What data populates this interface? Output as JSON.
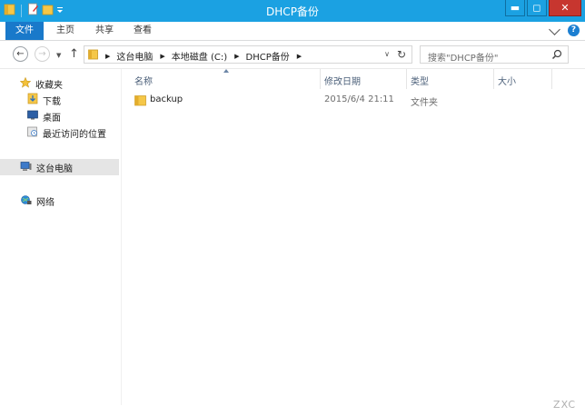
{
  "window": {
    "title": "DHCP备份",
    "minimize_glyph": "▬",
    "maximize_glyph": "◻",
    "close_glyph": "✕"
  },
  "ribbon": {
    "tabs": [
      {
        "label": "文件",
        "active": true
      },
      {
        "label": "主页"
      },
      {
        "label": "共享"
      },
      {
        "label": "查看"
      }
    ],
    "help_glyph": "?"
  },
  "nav": {
    "back_glyph": "←",
    "forward_glyph": "→",
    "recent_glyph": "▼",
    "up_glyph": "↑"
  },
  "address": {
    "breadcrumbs": [
      "这台电脑",
      "本地磁盘 (C:)",
      "DHCP备份"
    ],
    "sep_glyph": "▶",
    "dropdown_glyph": "∨",
    "refresh_glyph": "↻"
  },
  "search": {
    "placeholder": "搜索\"DHCP备份\""
  },
  "sidebar": {
    "favorites": {
      "label": "收藏夹",
      "icon": "star-icon"
    },
    "favorite_items": [
      {
        "label": "下载",
        "icon": "downloads-icon"
      },
      {
        "label": "桌面",
        "icon": "desktop-icon"
      },
      {
        "label": "最近访问的位置",
        "icon": "recent-places-icon"
      }
    ],
    "this_pc": {
      "label": "这台电脑",
      "icon": "computer-icon",
      "selected": true
    },
    "network": {
      "label": "网络",
      "icon": "network-icon"
    }
  },
  "columns": [
    {
      "label": "名称",
      "sorted": true
    },
    {
      "label": "修改日期"
    },
    {
      "label": "类型"
    },
    {
      "label": "大小"
    }
  ],
  "files": [
    {
      "name": "backup",
      "modified": "2015/6/4 21:11",
      "type": "文件夹",
      "size": "",
      "icon": "folder-icon"
    }
  ],
  "watermark": "ZXC",
  "colors": {
    "titlebar": "#1ba1e2",
    "file_tab": "#1979ca",
    "close_button": "#c7362f",
    "selected_nav": "#e5e5e5",
    "folder": "#f5c748"
  }
}
